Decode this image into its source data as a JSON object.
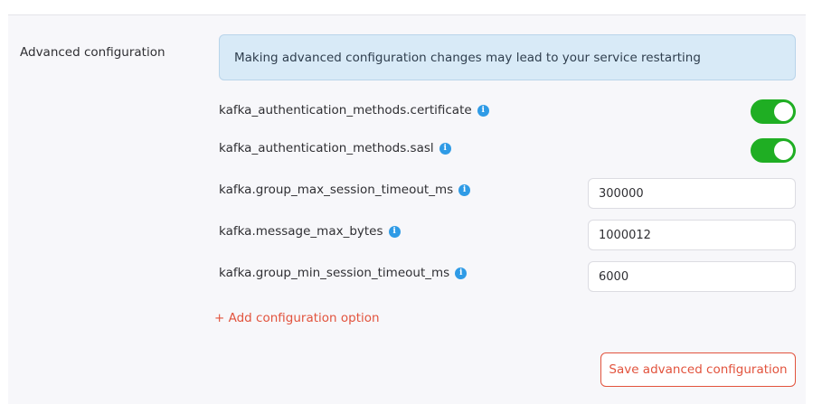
{
  "section": {
    "label": "Advanced configuration"
  },
  "alert": {
    "message": "Making advanced configuration changes may lead to your service restarting"
  },
  "options": [
    {
      "name": "kafka_authentication_methods.certificate",
      "type": "toggle",
      "enabled": true
    },
    {
      "name": "kafka_authentication_methods.sasl",
      "type": "toggle",
      "enabled": true
    },
    {
      "name": "kafka.group_max_session_timeout_ms",
      "type": "number",
      "value": "300000"
    },
    {
      "name": "kafka.message_max_bytes",
      "type": "number",
      "value": "1000012"
    },
    {
      "name": "kafka.group_min_session_timeout_ms",
      "type": "number",
      "value": "6000"
    }
  ],
  "actions": {
    "add_option": "+ Add configuration option",
    "save": "Save advanced configuration"
  },
  "icons": {
    "info": "info-icon"
  },
  "colors": {
    "toggle_on": "#1fae23",
    "accent": "#e2533d",
    "info": "#2f9be6",
    "alert_bg": "#d8eaf7"
  }
}
